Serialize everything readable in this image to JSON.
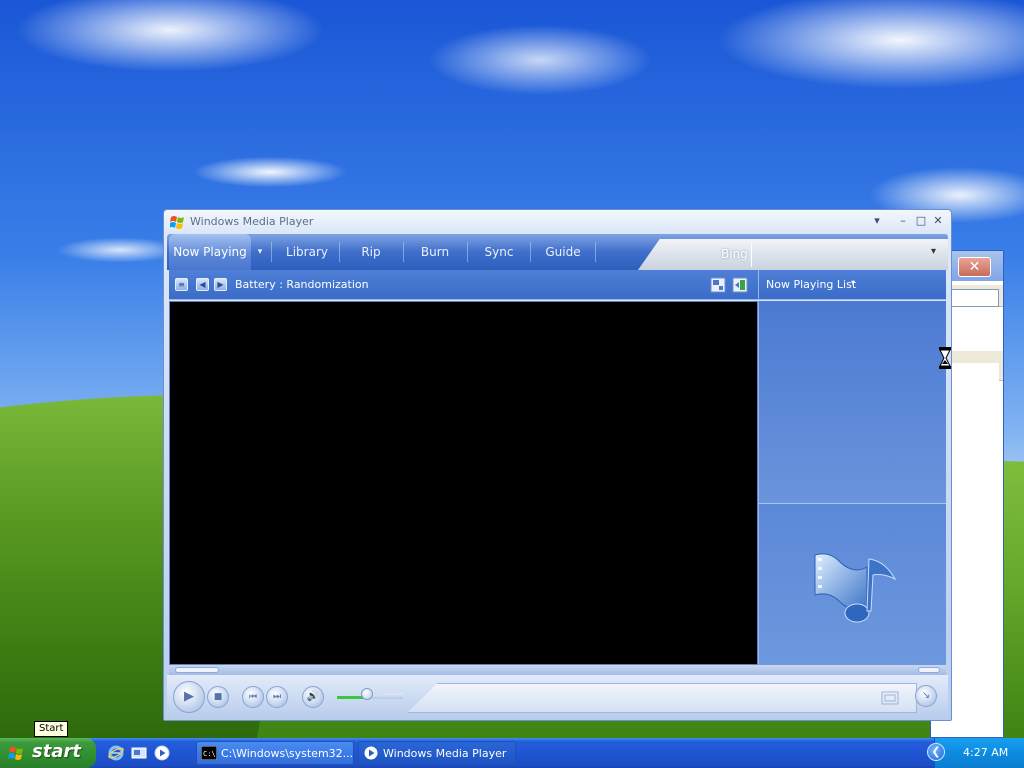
{
  "window": {
    "title": "Windows Media Player",
    "controls": {
      "menu": "▾",
      "minimize": "–",
      "maximize": "□",
      "close": "✕"
    }
  },
  "tabs": [
    {
      "label": "Now Playing",
      "active": true
    },
    {
      "label": "Library"
    },
    {
      "label": "Rip"
    },
    {
      "label": "Burn"
    },
    {
      "label": "Sync"
    },
    {
      "label": "Guide"
    }
  ],
  "tab_dropdown": "▾",
  "online_store": {
    "label": "Bing",
    "dropdown": "▾"
  },
  "info_bar": {
    "track": "Battery : Randomization",
    "prev_arrow": "◀",
    "next_arrow": "▶"
  },
  "playlist": {
    "label": "Now Playing List",
    "dropdown": "▾"
  },
  "playback": {
    "play": "▶",
    "stop": "■",
    "previous": "⏮",
    "next": "⏭",
    "mute": "🔊",
    "volume_percent": 45
  },
  "tooltip": {
    "text": "Start"
  },
  "taskbar": {
    "start_label": "start",
    "buttons": [
      {
        "label": "C:\\Windows\\system32..."
      },
      {
        "label": "Windows Media Player"
      }
    ],
    "clock": "4:27 AM",
    "tray_arrow": "❮"
  },
  "icons": {
    "wmp_logo": "windows-flag-icon",
    "art": "music-note-film-icon",
    "cursor": "hourglass-icon"
  },
  "colors": {
    "taskbar": "#245edb",
    "start_button": "#3c9a3c",
    "tray": "#0c8be0",
    "tab_bar": "#3f6fcb"
  }
}
